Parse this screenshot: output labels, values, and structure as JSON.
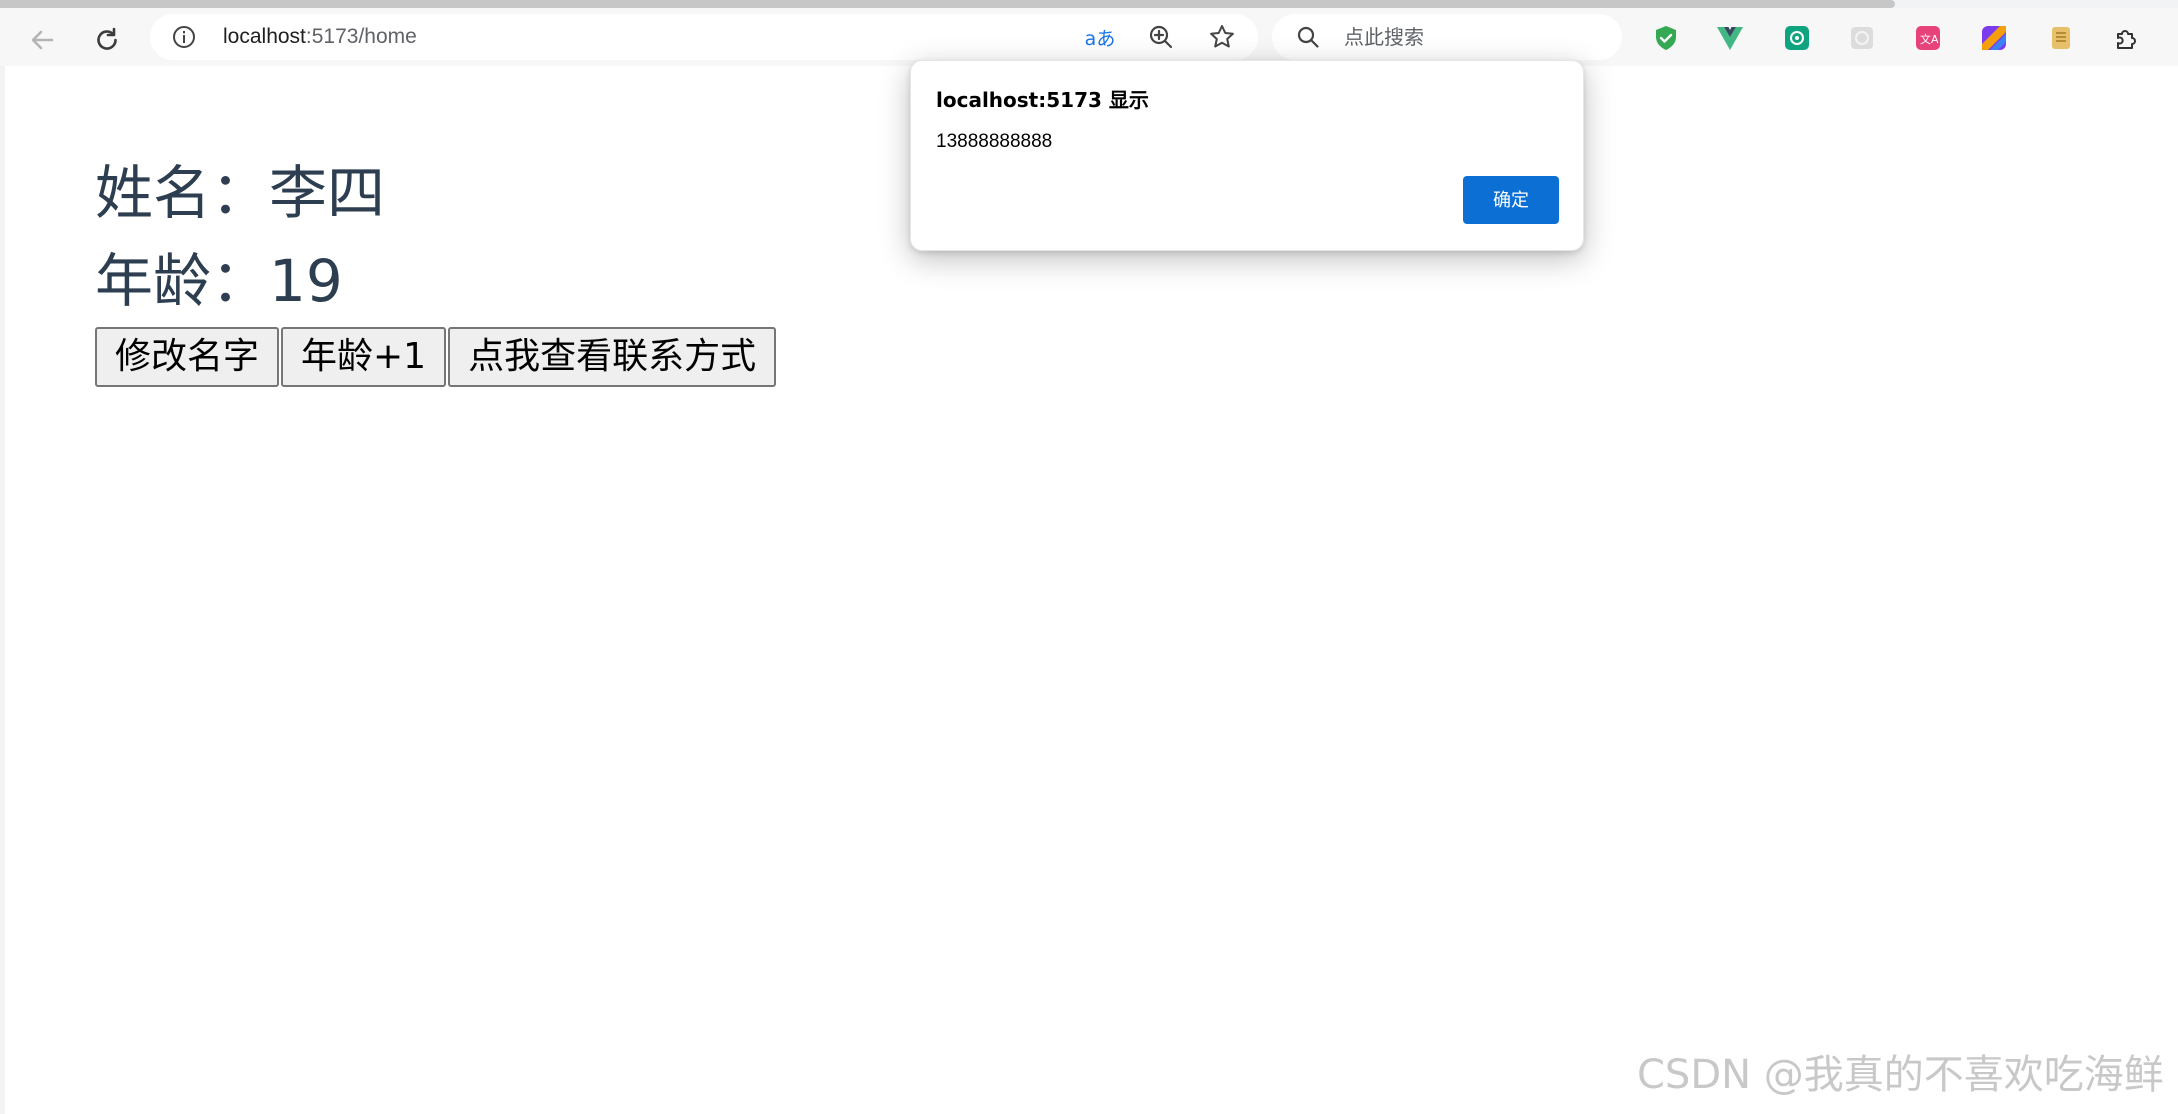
{
  "browser": {
    "url_host": "localhost",
    "url_rest": ":5173/home",
    "search_placeholder": "点此搜索",
    "translate_icon_text": "aあ",
    "icons": [
      "back-arrow-icon",
      "reload-icon",
      "site-info-icon",
      "translate-icon",
      "zoom-icon",
      "favorite-star-icon",
      "search-icon"
    ],
    "extensions": [
      "shield-extension-icon",
      "vue-devtools-icon",
      "chatgpt-extension-icon",
      "gray-extension-icon",
      "translate-extension-icon",
      "colorful-extension-icon",
      "notes-extension-icon",
      "puzzle-extensions-icon"
    ]
  },
  "page": {
    "name_line": "姓名：李四",
    "age_line": "年龄：19",
    "buttons": {
      "change_name": "修改名字",
      "age_plus": "年龄+1",
      "view_contact": "点我查看联系方式"
    },
    "text_color": "#2c3e50"
  },
  "alert": {
    "title": "localhost:5173 显示",
    "message": "13888888888",
    "ok_label": "确定",
    "ok_color": "#0b6fd4"
  },
  "watermark": "CSDN @我真的不喜欢吃海鲜"
}
